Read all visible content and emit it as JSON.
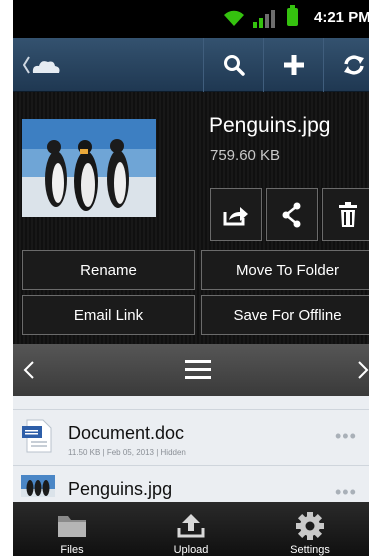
{
  "status_bar": {
    "time": "4:21 PM",
    "icons": [
      "wifi-icon",
      "signal-icon",
      "battery-icon"
    ]
  },
  "action_bar": {
    "icons": [
      "back-chevron-icon",
      "cloud-icon",
      "search-icon",
      "add-icon",
      "sync-icon"
    ]
  },
  "file_details": {
    "name": "Penguins.jpg",
    "size": "759.60 KB",
    "icon_actions": [
      "export-icon",
      "share-icon",
      "delete-icon"
    ],
    "actions": {
      "rename": "Rename",
      "move_to_folder": "Move To Folder",
      "email_link": "Email Link",
      "save_for_offline": "Save For Offline"
    }
  },
  "file_list": {
    "items": [
      {
        "name": "Document.doc",
        "meta": "11.50 KB | Feb 05, 2013 | Hidden",
        "icon": "doc-file-icon"
      },
      {
        "name": "Penguins.jpg",
        "icon": "image-thumbnail-icon"
      }
    ]
  },
  "bottom_tabs": [
    {
      "label": "Files",
      "icon": "folder-icon"
    },
    {
      "label": "Upload",
      "icon": "upload-icon"
    },
    {
      "label": "Settings",
      "icon": "gear-icon"
    }
  ],
  "colors": {
    "action_bar": "#2c4866",
    "status_battery": "#35c20f",
    "list_background": "#ebeef2"
  }
}
